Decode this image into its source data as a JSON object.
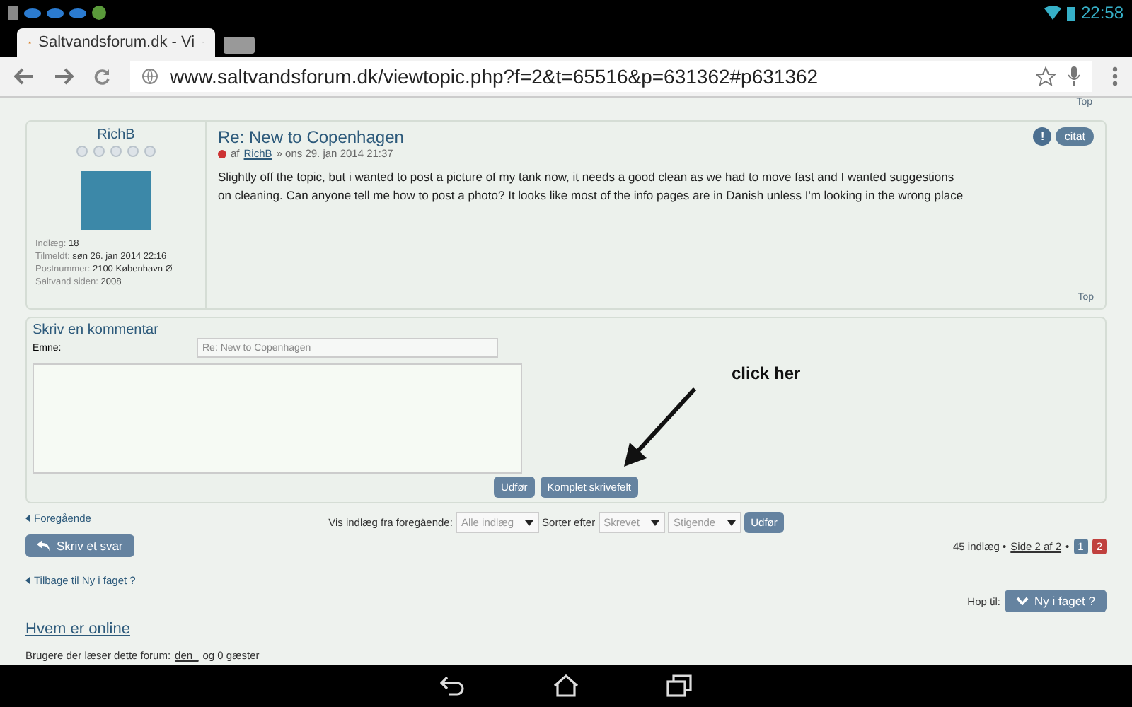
{
  "status_bar": {
    "time": "22:58"
  },
  "browser": {
    "tab_title": "Saltvandsforum.dk - Vi",
    "url": "www.saltvandsforum.dk/viewtopic.php?f=2&t=65516&p=631362#p631362"
  },
  "top_link": "Top",
  "post": {
    "author": "RichB",
    "title": "Re: New to Copenhagen",
    "byline_prefix": "af",
    "byline_author": "RichB",
    "byline_date": "» ons 29. jan 2014 21:37",
    "body": "Slightly off the topic, but i wanted to post a picture of my tank now, it needs a good clean as we had to move fast and I wanted suggestions on cleaning. Can anyone tell me how to post a photo? It looks like most of the info pages are in Danish unless I'm looking in the wrong place",
    "profile": [
      {
        "label": "Indlæg:",
        "value": "18"
      },
      {
        "label": "Tilmeldt:",
        "value": "søn 26. jan 2014 22:16"
      },
      {
        "label": "Postnummer:",
        "value": "2100 København Ø"
      },
      {
        "label": "Saltvand siden:",
        "value": "2008"
      }
    ],
    "report_button": "!",
    "quote_button": "citat",
    "top_link": "Top"
  },
  "reply": {
    "heading": "Skriv en kommentar",
    "subject_label": "Emne:",
    "subject_value": "Re: New to Copenhagen",
    "submit": "Udfør",
    "full_editor": "Komplet skrivefelt",
    "annotation": "click her"
  },
  "nav": {
    "previous": "Foregående",
    "display_label": "Vis indlæg fra foregående:",
    "display_value": "Alle indlæg",
    "sort_label": "Sorter efter",
    "sort_value": "Skrevet",
    "order_value": "Stigende",
    "go": "Udfør",
    "reply_button": "Skriv et svar",
    "post_count": "45 indlæg •",
    "page_link": "Side 2 af 2",
    "separator": "•",
    "pages": [
      {
        "label": "1",
        "selected": false
      },
      {
        "label": "2",
        "selected": true
      }
    ],
    "back": "Tilbage til Ny i faget ?",
    "jump_label": "Hop til:",
    "jump_button": "Ny i faget ?"
  },
  "online": {
    "heading": "Hvem er online",
    "text_prefix": "Brugere der læser dette forum:",
    "user": "den_",
    "text_suffix": "og 0 gæster"
  }
}
